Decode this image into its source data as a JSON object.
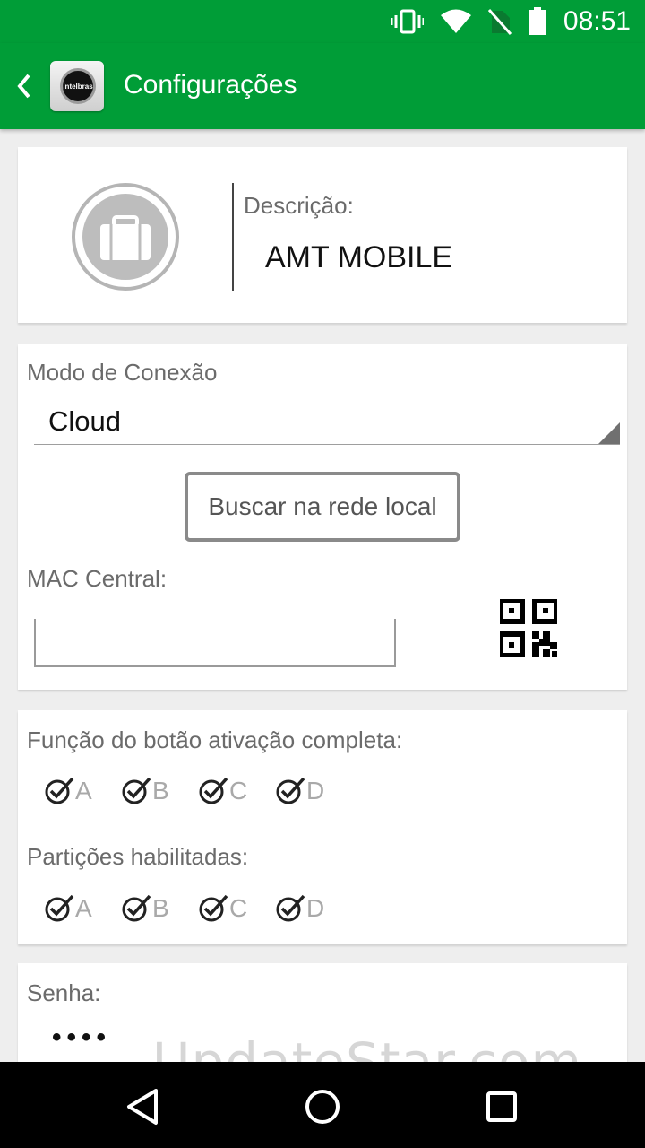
{
  "status_bar": {
    "time": "08:51",
    "icons": [
      "vibrate-icon",
      "wifi-icon",
      "no-sim-icon",
      "battery-icon"
    ]
  },
  "app_bar": {
    "title": "Configurações",
    "logo_text": "intelbras"
  },
  "device": {
    "description_label": "Descrição:",
    "description_value": "AMT MOBILE",
    "icon": "briefcase-icon"
  },
  "connection": {
    "mode_label": "Modo de Conexão",
    "mode_value": "Cloud",
    "search_button_label": "Buscar na rede local",
    "mac_label": "MAC Central:",
    "mac_value": "",
    "qr_icon": "qr-code-icon"
  },
  "activation": {
    "full_activation_label": "Função do botão ativação completa:",
    "full_activation_options": [
      "A",
      "B",
      "C",
      "D"
    ],
    "partitions_label": "Partições habilitadas:",
    "partitions_options": [
      "A",
      "B",
      "C",
      "D"
    ]
  },
  "password": {
    "label": "Senha:",
    "value": "••••"
  },
  "watermark": "UpdateStar.com",
  "colors": {
    "accent": "#009d37",
    "background": "#eeeeee",
    "card": "#ffffff"
  }
}
